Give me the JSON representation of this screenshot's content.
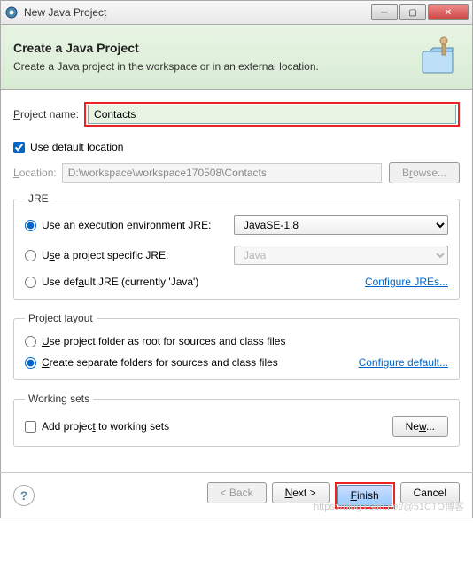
{
  "window": {
    "title": "New Java Project"
  },
  "banner": {
    "title": "Create a Java Project",
    "desc": "Create a Java project in the workspace or in an external location."
  },
  "fields": {
    "project_name_label": "Project name:",
    "project_name_value": "Contacts",
    "use_default_label": "Use default location",
    "location_label": "Location:",
    "location_value": "D:\\workspace\\workspace170508\\Contacts",
    "browse_label": "Browse..."
  },
  "jre": {
    "legend": "JRE",
    "opt1_label": "Use an execution environment JRE:",
    "opt1_value": "JavaSE-1.8",
    "opt2_label": "Use a project specific JRE:",
    "opt2_value": "Java",
    "opt3_label": "Use default JRE (currently 'Java')",
    "configure_link": "Configure JREs..."
  },
  "layout": {
    "legend": "Project layout",
    "opt1_label": "Use project folder as root for sources and class files",
    "opt2_label": "Create separate folders for sources and class files",
    "configure_link": "Configure default..."
  },
  "working_sets": {
    "legend": "Working sets",
    "checkbox_label": "Add project to working sets",
    "new_label": "New..."
  },
  "footer": {
    "back": "< Back",
    "next": "Next >",
    "finish": "Finish",
    "cancel": "Cancel"
  },
  "watermark": "https://blog.csdn.net/@51CTO博客"
}
